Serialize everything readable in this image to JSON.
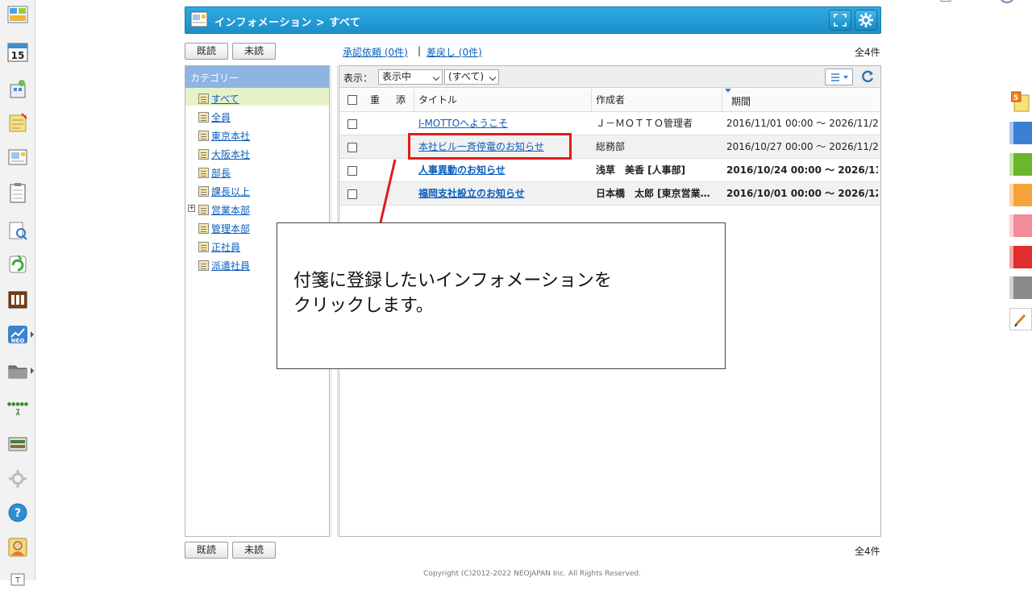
{
  "header": {
    "title": "インフォメーション > すべて"
  },
  "toolbar_top": {
    "read_button": "既読",
    "unread_button": "未読",
    "approval_link": "承認依頼 (0件)",
    "separator": "|",
    "return_link": "差戻し (0件)",
    "count": "全4件"
  },
  "categories": {
    "header": "カテゴリー",
    "items": [
      {
        "label": "すべて",
        "selected": true
      },
      {
        "label": "全員"
      },
      {
        "label": "東京本社"
      },
      {
        "label": "大阪本社"
      },
      {
        "label": "部長"
      },
      {
        "label": "課長以上"
      },
      {
        "label": "営業本部",
        "expandable": true
      },
      {
        "label": "管理本部"
      },
      {
        "label": "正社員"
      },
      {
        "label": "派遣社員"
      }
    ],
    "expand_symbol": "+"
  },
  "list": {
    "display_label": "表示：",
    "filter1": "表示中",
    "filter2": "(すべて)",
    "columns": {
      "dup": "重",
      "attach": "添",
      "title": "タイトル",
      "author": "作成者",
      "period": "期間"
    },
    "rows": [
      {
        "title": "J-MOTTOへようこそ",
        "author": "Ｊ－ＭＯＴＴＯ管理者",
        "period": "2016/11/01 00:00 ～ 2026/11/2…",
        "unread": false
      },
      {
        "title": "本社ビル一斉停電のお知らせ",
        "author": "総務部",
        "period": "2016/10/27 00:00 ～ 2026/11/2…",
        "unread": false
      },
      {
        "title": "人事異動のお知らせ",
        "author": "浅草　美香 [人事部]",
        "period": "2016/10/24 00:00 ～ 2026/11…",
        "unread": true
      },
      {
        "title": "福岡支社設立のお知らせ",
        "author": "日本橋　太郎 [東京営業…",
        "period": "2016/10/01 00:00 ～ 2026/12…",
        "unread": true
      }
    ]
  },
  "toolbar_bottom": {
    "read_button": "既読",
    "unread_button": "未読",
    "count": "全4件"
  },
  "callout": {
    "line1": "付箋に登録したいインフォメーションを",
    "line2": "クリックします。"
  },
  "footer": "Copyright (C)2012-2022 NEOJAPAN Inc. All Rights Reserved.",
  "leftbar_icons": [
    "portal-icon",
    "calendar-icon",
    "facility-icon",
    "memo-icon",
    "information-icon",
    "todo-icon",
    "search-icon",
    "workflow-icon",
    "timecard-icon",
    "neo-icon",
    "folder-icon",
    "ranking-icon",
    "board-icon",
    "settings-icon",
    "help-icon",
    "user-icon",
    "text-icon"
  ],
  "calendar_day": "15",
  "sticky_badge": "5",
  "colors": {
    "header_blue": "#1b8fcb",
    "category_header": "#8db4e2",
    "selected_category": "#e5f2c9",
    "link": "#0b5dbb",
    "highlight": "#e31b1b"
  }
}
